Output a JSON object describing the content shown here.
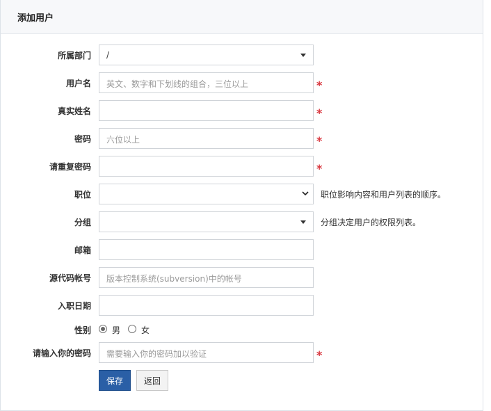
{
  "header": {
    "title": "添加用户"
  },
  "form": {
    "dept": {
      "label": "所属部门",
      "value": "/"
    },
    "account": {
      "label": "用户名",
      "placeholder": "英文、数字和下划线的组合，三位以上",
      "required": "*"
    },
    "realname": {
      "label": "真实姓名",
      "required": "*"
    },
    "password": {
      "label": "密码",
      "placeholder": "六位以上",
      "required": "*"
    },
    "password2": {
      "label": "请重复密码",
      "required": "*"
    },
    "role": {
      "label": "职位",
      "help": "职位影响内容和用户列表的顺序。"
    },
    "group": {
      "label": "分组",
      "help": "分组决定用户的权限列表。"
    },
    "email": {
      "label": "邮箱"
    },
    "commiter": {
      "label": "源代码帐号",
      "placeholder": "版本控制系统(subversion)中的帐号"
    },
    "join": {
      "label": "入职日期"
    },
    "gender": {
      "label": "性别",
      "options": [
        "男",
        "女"
      ],
      "selected": "男"
    },
    "verify": {
      "label": "请输入你的密码",
      "placeholder": "需要输入你的密码加以验证",
      "required": "*"
    }
  },
  "actions": {
    "save": "保存",
    "back": "返回"
  }
}
